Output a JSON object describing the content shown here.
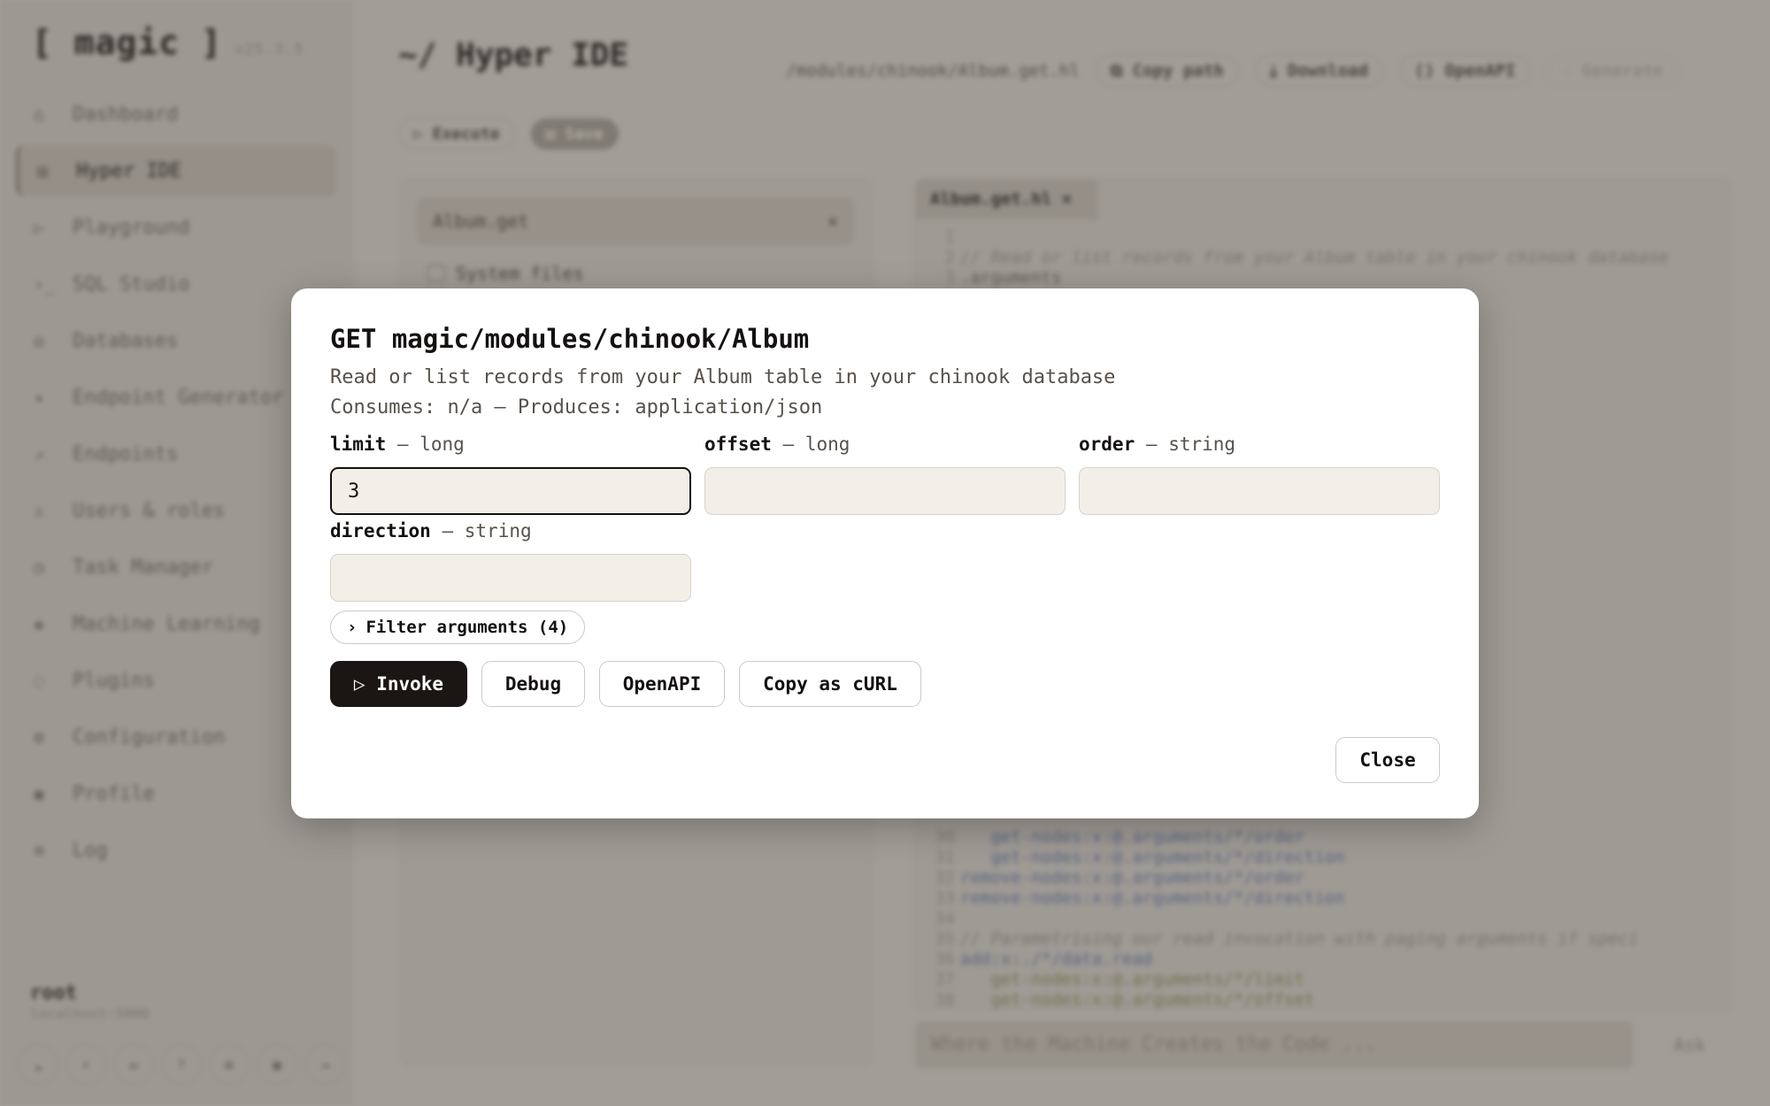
{
  "sidebar": {
    "brand": "[ magic ]",
    "version": "v25.3.5",
    "items": [
      {
        "label": "Dashboard",
        "icon": "home-icon"
      },
      {
        "label": "Hyper IDE",
        "icon": "file-icon"
      },
      {
        "label": "Playground",
        "icon": "play-icon"
      },
      {
        "label": "SQL Studio",
        "icon": "terminal-icon"
      },
      {
        "label": "Databases",
        "icon": "database-icon"
      },
      {
        "label": "Endpoint Generator",
        "icon": "sparkle-icon"
      },
      {
        "label": "Endpoints",
        "icon": "chart-icon"
      },
      {
        "label": "Users & roles",
        "icon": "user-icon"
      },
      {
        "label": "Task Manager",
        "icon": "clock-icon"
      },
      {
        "label": "Machine Learning",
        "icon": "ml-icon"
      },
      {
        "label": "Plugins",
        "icon": "plugin-icon"
      },
      {
        "label": "Configuration",
        "icon": "config-icon"
      },
      {
        "label": "Profile",
        "icon": "profile-icon"
      },
      {
        "label": "Log",
        "icon": "log-icon"
      }
    ],
    "user": "root",
    "host": "localhost:5000"
  },
  "header": {
    "title": "~/ Hyper IDE",
    "path": "/modules/chinook/Album.get.hl",
    "copy_path": "Copy path",
    "download": "Download",
    "openapi": "OpenAPI",
    "generate": "Generate",
    "execute": "Execute",
    "save": "Save"
  },
  "files": {
    "search_value": "Album.get",
    "system_files": "System files"
  },
  "editor": {
    "tab": "Album.get.hl",
    "lines": [
      {
        "n": "1",
        "t": ""
      },
      {
        "n": "2",
        "t": "// Read or list records from your Album table in your chinook database"
      },
      {
        "n": "3",
        "t": ".arguments"
      }
    ],
    "lines_bottom": [
      {
        "n": "30",
        "t": "   get-nodes:x:@.arguments/*/order"
      },
      {
        "n": "31",
        "t": "   get-nodes:x:@.arguments/*/direction"
      },
      {
        "n": "32",
        "t": "remove-nodes:x:@.arguments/*/order"
      },
      {
        "n": "33",
        "t": "remove-nodes:x:@.arguments/*/direction"
      },
      {
        "n": "34",
        "t": ""
      },
      {
        "n": "35",
        "t": "// Parametrising our read invocation with paging arguments if speci"
      },
      {
        "n": "36",
        "t": "add:x:./*/data.read"
      },
      {
        "n": "37",
        "t": "   get-nodes:x:@.arguments/*/limit"
      },
      {
        "n": "38",
        "t": "   get-nodes:x:@.arguments/*/offset"
      }
    ],
    "ask_placeholder": "Where the Machine Creates the Code ...",
    "ask_button": "Ask"
  },
  "modal": {
    "title": "GET magic/modules/chinook/Album",
    "description": "Read or list records from your Album table in your chinook database",
    "meta": "Consumes: n/a — Produces: application/json",
    "fields": [
      {
        "name": "limit",
        "type": "long",
        "value": "3"
      },
      {
        "name": "offset",
        "type": "long",
        "value": ""
      },
      {
        "name": "order",
        "type": "string",
        "value": ""
      },
      {
        "name": "direction",
        "type": "string",
        "value": ""
      }
    ],
    "sep": "—",
    "filter_label": "Filter arguments (4)",
    "invoke": "▷ Invoke",
    "debug": "Debug",
    "openapi": "OpenAPI",
    "curl": "Copy as cURL",
    "close": "Close"
  }
}
